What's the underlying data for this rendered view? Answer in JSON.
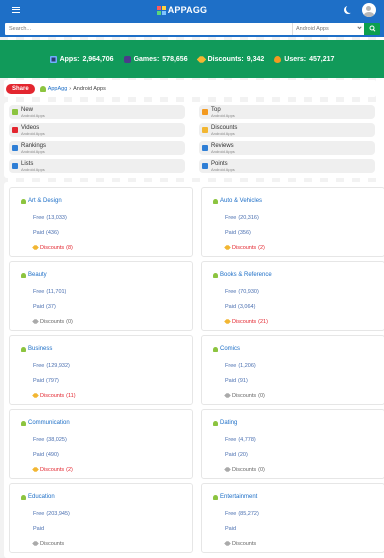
{
  "header": {
    "logo_text": "APPAGG"
  },
  "search": {
    "placeholder": "Search...",
    "scope": "Android Apps"
  },
  "stats": [
    {
      "label": "Apps:",
      "value": "2,964,706"
    },
    {
      "label": "Games:",
      "value": "578,656"
    },
    {
      "label": "Discounts:",
      "value": "9,342"
    },
    {
      "label": "Users:",
      "value": "457,217"
    }
  ],
  "breadcrumb": {
    "share_label": "Share",
    "home": "AppAgg",
    "separator": "›",
    "current": "Android Apps"
  },
  "nav": [
    {
      "title": "New",
      "sub": "Android Apps",
      "icon": "new-icon",
      "color": "#8cc43f"
    },
    {
      "title": "Top",
      "sub": "Android Apps",
      "icon": "top-icon",
      "color": "#f39a20"
    },
    {
      "title": "Videos",
      "sub": "Android Apps",
      "icon": "videos-icon",
      "color": "#e3262f"
    },
    {
      "title": "Discounts",
      "sub": "Android Apps",
      "icon": "discounts-icon",
      "color": "#f2b632"
    },
    {
      "title": "Rankings",
      "sub": "Android Apps",
      "icon": "rankings-icon",
      "color": "#2f7fd6"
    },
    {
      "title": "Reviews",
      "sub": "Android Apps",
      "icon": "reviews-icon",
      "color": "#2f7fd6"
    },
    {
      "title": "Lists",
      "sub": "Android Apps",
      "icon": "lists-icon",
      "color": "#2f7fd6"
    },
    {
      "title": "Points",
      "sub": "Android Apps",
      "icon": "points-icon",
      "color": "#2f7fd6"
    }
  ],
  "categories": [
    {
      "name": "Art & Design",
      "free": "Free",
      "free_count": "(13,033)",
      "paid": "Paid",
      "paid_count": "(436)",
      "disc": "Discounts",
      "disc_count": "(8)",
      "hot": true
    },
    {
      "name": "Auto & Vehicles",
      "free": "Free",
      "free_count": "(20,316)",
      "paid": "Paid",
      "paid_count": "(356)",
      "disc": "Discounts",
      "disc_count": "(2)",
      "hot": true
    },
    {
      "name": "Beauty",
      "free": "Free",
      "free_count": "(11,701)",
      "paid": "Paid",
      "paid_count": "(37)",
      "disc": "Discounts",
      "disc_count": "(0)",
      "hot": false
    },
    {
      "name": "Books & Reference",
      "free": "Free",
      "free_count": "(70,930)",
      "paid": "Paid",
      "paid_count": "(3,064)",
      "disc": "Discounts",
      "disc_count": "(21)",
      "hot": true
    },
    {
      "name": "Business",
      "free": "Free",
      "free_count": "(129,932)",
      "paid": "Paid",
      "paid_count": "(797)",
      "disc": "Discounts",
      "disc_count": "(11)",
      "hot": true
    },
    {
      "name": "Comics",
      "free": "Free",
      "free_count": "(1,206)",
      "paid": "Paid",
      "paid_count": "(91)",
      "disc": "Discounts",
      "disc_count": "(0)",
      "hot": false
    },
    {
      "name": "Communication",
      "free": "Free",
      "free_count": "(38,025)",
      "paid": "Paid",
      "paid_count": "(490)",
      "disc": "Discounts",
      "disc_count": "(2)",
      "hot": true
    },
    {
      "name": "Dating",
      "free": "Free",
      "free_count": "(4,778)",
      "paid": "Paid",
      "paid_count": "(20)",
      "disc": "Discounts",
      "disc_count": "(0)",
      "hot": false
    },
    {
      "name": "Education",
      "free": "Free",
      "free_count": "(203,945)",
      "paid": "Paid",
      "paid_count": "",
      "disc": "Discounts",
      "disc_count": "",
      "hot": false
    },
    {
      "name": "Entertainment",
      "free": "Free",
      "free_count": "(85,272)",
      "paid": "Paid",
      "paid_count": "",
      "disc": "Discounts",
      "disc_count": "",
      "hot": false
    }
  ]
}
